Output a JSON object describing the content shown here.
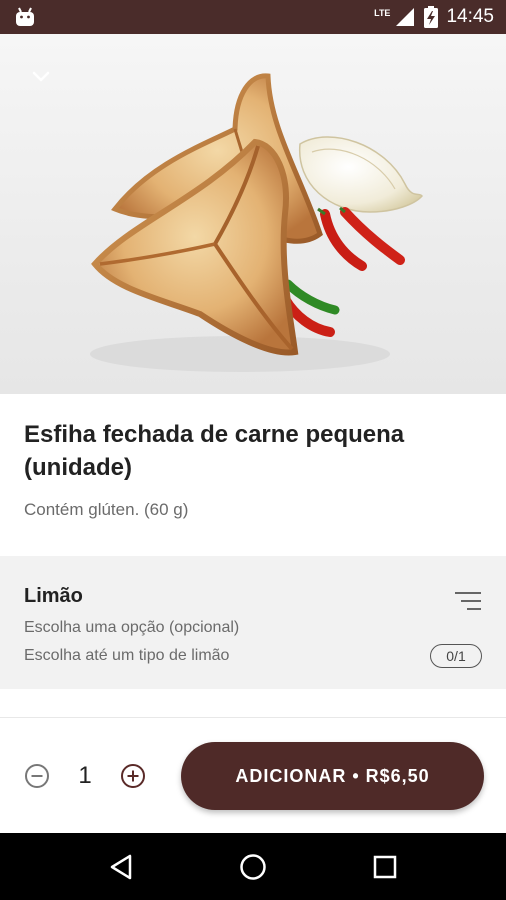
{
  "status_bar": {
    "network": "LTE",
    "time": "14:45"
  },
  "product": {
    "title": "Esfiha fechada de carne pequena (unidade)",
    "description": "Contém glúten. (60 g)"
  },
  "option_group": {
    "title": "Limão",
    "subtitle": "Escolha uma opção (opcional)",
    "hint": "Escolha até um tipo de limão",
    "count": "0/1"
  },
  "cart": {
    "quantity": "1",
    "add_label": "ADICIONAR • R$6,50"
  },
  "colors": {
    "brand": "#4f2a28",
    "status_bar": "#4a2c2a"
  },
  "icons": [
    "android-icon",
    "signal-icon",
    "battery-icon",
    "chevron-down-icon",
    "filter-icon",
    "minus-icon",
    "plus-icon",
    "back-icon",
    "home-icon",
    "recents-icon"
  ]
}
